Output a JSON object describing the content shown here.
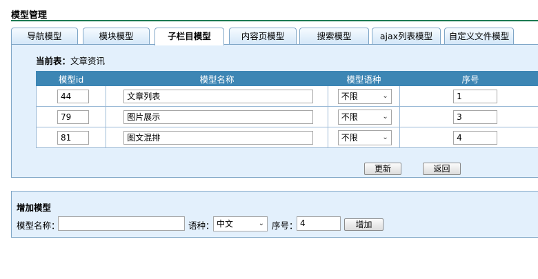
{
  "page_title": "模型管理",
  "tabs": [
    {
      "label": "导航模型",
      "active": false
    },
    {
      "label": "模块模型",
      "active": false
    },
    {
      "label": "子栏目模型",
      "active": true
    },
    {
      "label": "内容页模型",
      "active": false
    },
    {
      "label": "搜索模型",
      "active": false
    },
    {
      "label": "ajax列表模型",
      "active": false
    },
    {
      "label": "自定义文件模型",
      "active": false
    }
  ],
  "current_table": {
    "label": "当前表：",
    "value": "文章资讯"
  },
  "table": {
    "headers": [
      "模型id",
      "模型名称",
      "模型语种",
      "序号"
    ],
    "rows": [
      {
        "id": "44",
        "name": "文章列表",
        "lang": "不限",
        "order": "1"
      },
      {
        "id": "79",
        "name": "图片展示",
        "lang": "不限",
        "order": "3"
      },
      {
        "id": "81",
        "name": "图文混排",
        "lang": "不限",
        "order": "4"
      }
    ]
  },
  "buttons": {
    "update": "更新",
    "back": "返回"
  },
  "add_model": {
    "title": "增加模型",
    "name_label": "模型名称：",
    "name_value": "",
    "lang_label": "语种：",
    "lang_value": "中文",
    "order_label": "序号：",
    "order_value": "4",
    "add_button": "增加"
  },
  "colors": {
    "header_bg": "#3d86b4",
    "panel_bg": "#e3f0fc",
    "title_line": "#1b7a52"
  }
}
